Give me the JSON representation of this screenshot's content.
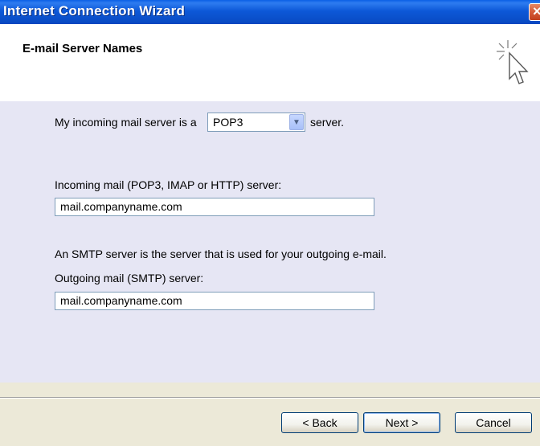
{
  "window": {
    "title": "Internet Connection Wizard"
  },
  "header": {
    "title": "E-mail Server Names",
    "icon": "wizard-pointer-icon"
  },
  "incoming": {
    "prefix": "My incoming mail server is a",
    "server_type": "POP3",
    "suffix": "server.",
    "label": "Incoming mail (POP3, IMAP or HTTP) server:",
    "value": "mail.companyname.com"
  },
  "smtp": {
    "description": "An SMTP server is the server that is used for your outgoing e-mail.",
    "label": "Outgoing mail (SMTP) server:",
    "value": "mail.companyname.com"
  },
  "buttons": {
    "back": "< Back",
    "next": "Next >",
    "cancel": "Cancel"
  },
  "colors": {
    "titlebar": "#0A4FC9",
    "content_bg": "#E6E6F4",
    "close_button": "#D65C3A"
  }
}
